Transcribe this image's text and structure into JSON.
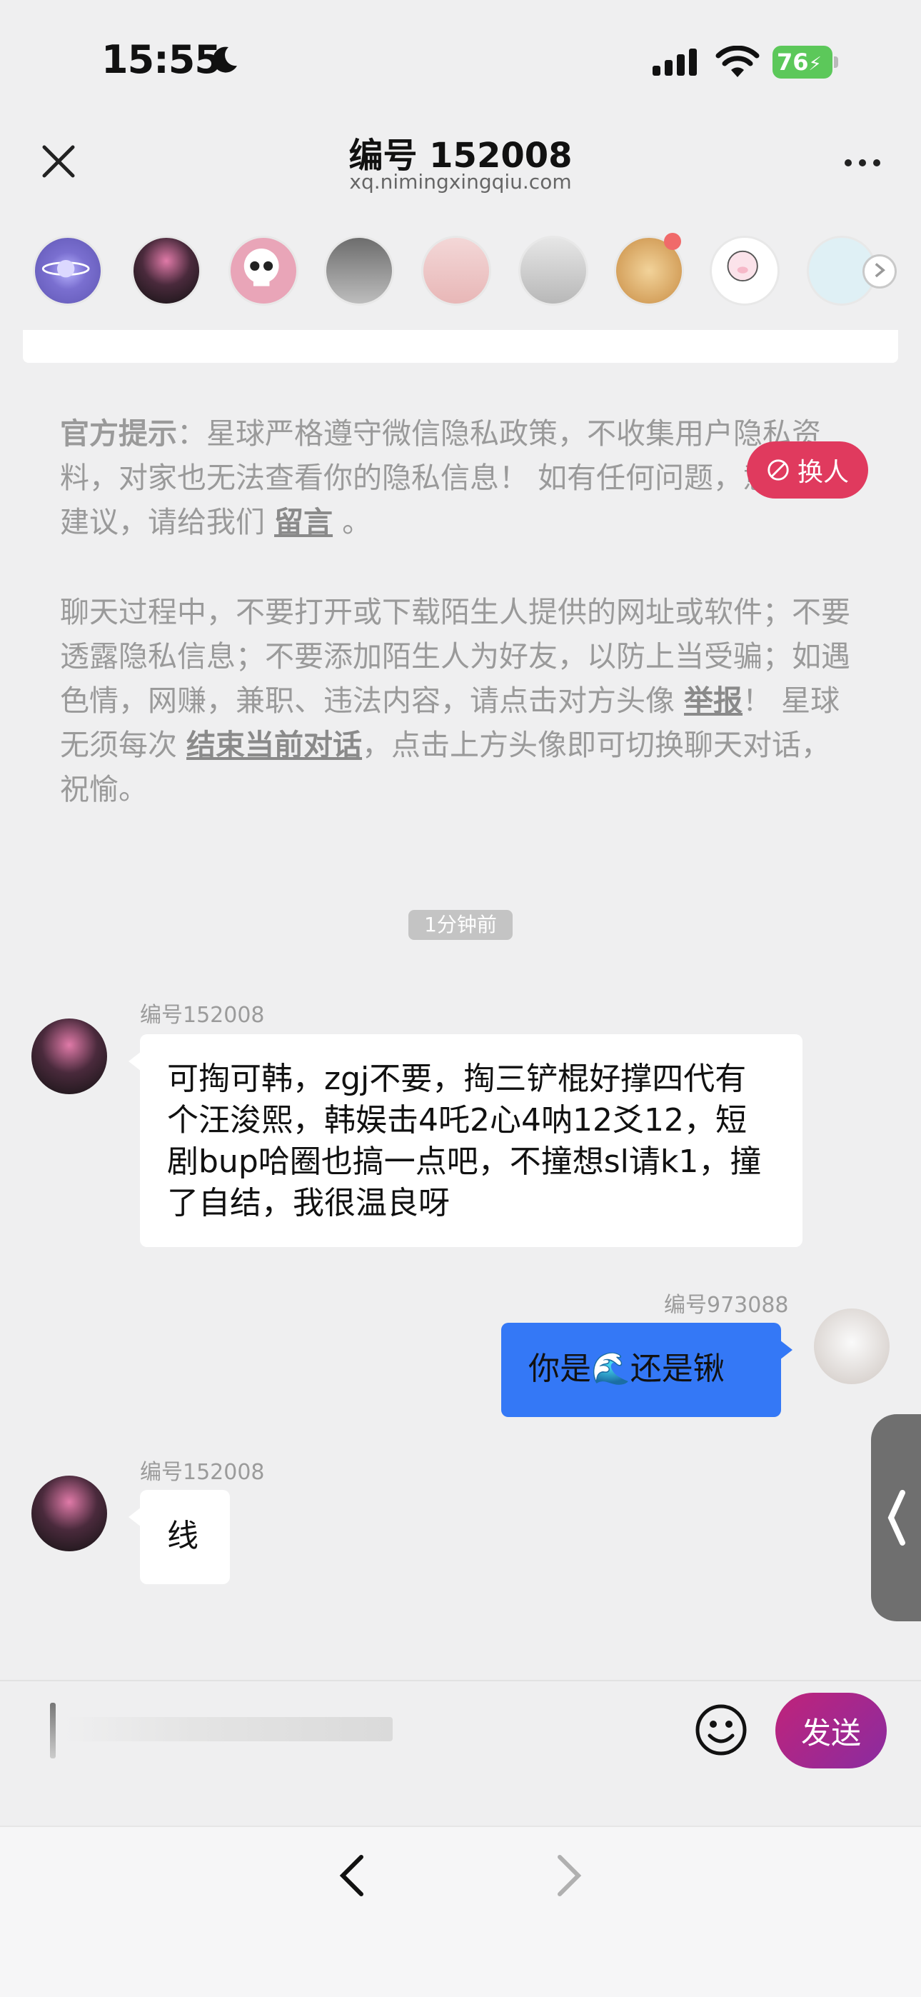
{
  "status_bar": {
    "time": "15:55",
    "battery": "76"
  },
  "header": {
    "title": "编号 152008",
    "subtitle": "xq.nimingxingqiu.com"
  },
  "notice": {
    "p1_bold": "官方提示",
    "p1_text": "：星球严格遵守微信隐私政策，不收集用户隐私资料，对家也无法查看你的隐私信息！ 如有任何问题，意见，建议，请给我们",
    "p1_link": "留言",
    "p1_end": "。",
    "p2_a": "聊天过程中，不要打开或下载陌生人提供的网址或软件；不要透露隐私信息；不要添加陌生人为好友，以防上当受骗；如遇色情，网赚，兼职、违法内容，请点击对方头像",
    "p2_link1": "举报",
    "p2_b": "！ 星球无须每次",
    "p2_link2": "结束当前对话",
    "p2_c": "，点击上方头像即可切换聊天对话，祝愉。"
  },
  "swap_button": "换人",
  "time_label": "1分钟前",
  "messages": [
    {
      "sender": "编号152008",
      "text": "可掏可韩，zgj不要，掏三铲棍好撑四代有个汪浚熙，韩娱击4吒2心4呐12爻12，短剧bup哈圈也搞一点吧，不撞想sl请k1，撞了自结，我很温良呀"
    },
    {
      "sender": "编号973088",
      "text_a": "你是",
      "emoji": "🌊",
      "text_b": "还是锹"
    },
    {
      "sender": "编号152008",
      "text": "线"
    }
  ],
  "input": {
    "send_label": "发送"
  },
  "colors": {
    "send": "#b0278a",
    "bubble_right": "#3478f6",
    "swap": "#e03a5e"
  }
}
